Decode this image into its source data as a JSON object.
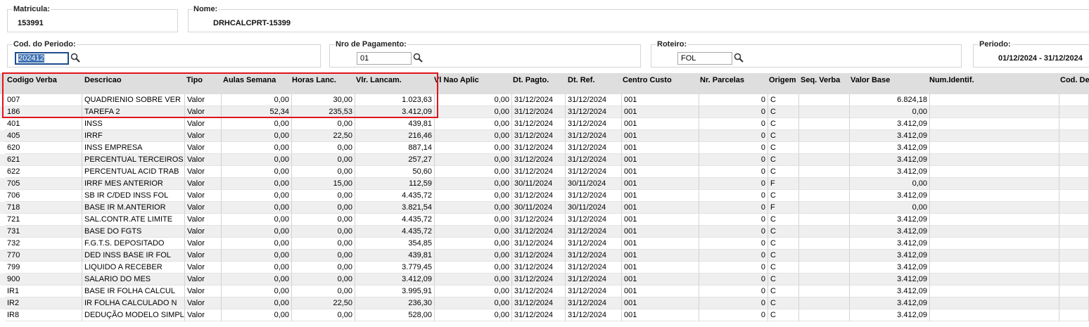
{
  "matricula": {
    "label": "Matricula:",
    "value": "153991"
  },
  "nome": {
    "label": "Nome:",
    "value": "DRHCALCPRT-15399"
  },
  "cod_periodo": {
    "label": "Cod. do Periodo:",
    "value": "202412"
  },
  "nro_pagamento": {
    "label": "Nro de Pagamento:",
    "value": "01"
  },
  "roteiro": {
    "label": "Roteiro:",
    "value": "FOL"
  },
  "periodo": {
    "label": "Periodo:",
    "value": "01/12/2024 - 31/12/2024"
  },
  "icons": {
    "search": "magnifier-icon"
  },
  "colors": {
    "highlight": "#e0141b",
    "header_bg": "#dedede",
    "row_alt": "#efefef"
  },
  "table": {
    "headers": [
      "Codigo Verba",
      "Descricao",
      "Tipo",
      "Aulas Semana",
      "Horas Lanc.",
      "Vlr. Lancam.",
      "Vl Nao Aplic",
      "Dt. Pagto.",
      "Dt. Ref.",
      "Centro Custo",
      "Nr. Parcelas",
      "Origem",
      "Seq. Verba",
      "Valor Base",
      "Num.Identif.",
      "Cod. De"
    ],
    "rows": [
      [
        "007",
        "QUADRIENIO SOBRE VER",
        "Valor",
        "0,00",
        "30,00",
        "1.023,63",
        "0,00",
        "31/12/2024",
        "31/12/2024",
        "001",
        "0",
        "C",
        "",
        "6.824,18",
        "",
        ""
      ],
      [
        "186",
        "TAREFA 2",
        "Valor",
        "52,34",
        "235,53",
        "3.412,09",
        "0,00",
        "31/12/2024",
        "31/12/2024",
        "001",
        "0",
        "C",
        "",
        "0,00",
        "",
        ""
      ],
      [
        "401",
        "INSS",
        "Valor",
        "0,00",
        "0,00",
        "439,81",
        "0,00",
        "31/12/2024",
        "31/12/2024",
        "001",
        "0",
        "C",
        "",
        "3.412,09",
        "",
        ""
      ],
      [
        "405",
        "IRRF",
        "Valor",
        "0,00",
        "22,50",
        "216,46",
        "0,00",
        "31/12/2024",
        "31/12/2024",
        "001",
        "0",
        "C",
        "",
        "3.412,09",
        "",
        ""
      ],
      [
        "620",
        "INSS EMPRESA",
        "Valor",
        "0,00",
        "0,00",
        "887,14",
        "0,00",
        "31/12/2024",
        "31/12/2024",
        "001",
        "0",
        "C",
        "",
        "3.412,09",
        "",
        ""
      ],
      [
        "621",
        "PERCENTUAL TERCEIROS",
        "Valor",
        "0,00",
        "0,00",
        "257,27",
        "0,00",
        "31/12/2024",
        "31/12/2024",
        "001",
        "0",
        "C",
        "",
        "3.412,09",
        "",
        ""
      ],
      [
        "622",
        "PERCENTUAL ACID TRAB",
        "Valor",
        "0,00",
        "0,00",
        "50,60",
        "0,00",
        "31/12/2024",
        "31/12/2024",
        "001",
        "0",
        "C",
        "",
        "3.412,09",
        "",
        ""
      ],
      [
        "705",
        "IRRF MES ANTERIOR",
        "Valor",
        "0,00",
        "15,00",
        "112,59",
        "0,00",
        "30/11/2024",
        "30/11/2024",
        "001",
        "0",
        "F",
        "",
        "0,00",
        "",
        ""
      ],
      [
        "706",
        "SB IR C/DED INSS FOL",
        "Valor",
        "0,00",
        "0,00",
        "4.435,72",
        "0,00",
        "31/12/2024",
        "31/12/2024",
        "001",
        "0",
        "C",
        "",
        "3.412,09",
        "",
        ""
      ],
      [
        "718",
        "BASE IR M.ANTERIOR",
        "Valor",
        "0,00",
        "0,00",
        "3.821,54",
        "0,00",
        "30/11/2024",
        "30/11/2024",
        "001",
        "0",
        "F",
        "",
        "0,00",
        "",
        ""
      ],
      [
        "721",
        "SAL.CONTR.ATE LIMITE",
        "Valor",
        "0,00",
        "0,00",
        "4.435,72",
        "0,00",
        "31/12/2024",
        "31/12/2024",
        "001",
        "0",
        "C",
        "",
        "3.412,09",
        "",
        ""
      ],
      [
        "731",
        "BASE DO FGTS",
        "Valor",
        "0,00",
        "0,00",
        "4.435,72",
        "0,00",
        "31/12/2024",
        "31/12/2024",
        "001",
        "0",
        "C",
        "",
        "3.412,09",
        "",
        ""
      ],
      [
        "732",
        "F.G.T.S.  DEPOSITADO",
        "Valor",
        "0,00",
        "0,00",
        "354,85",
        "0,00",
        "31/12/2024",
        "31/12/2024",
        "001",
        "0",
        "C",
        "",
        "3.412,09",
        "",
        ""
      ],
      [
        "770",
        "DED INSS BASE IR FOL",
        "Valor",
        "0,00",
        "0,00",
        "439,81",
        "0,00",
        "31/12/2024",
        "31/12/2024",
        "001",
        "0",
        "C",
        "",
        "3.412,09",
        "",
        ""
      ],
      [
        "799",
        "LIQUIDO A RECEBER",
        "Valor",
        "0,00",
        "0,00",
        "3.779,45",
        "0,00",
        "31/12/2024",
        "31/12/2024",
        "001",
        "0",
        "C",
        "",
        "3.412,09",
        "",
        ""
      ],
      [
        "900",
        "SALARIO DO MES",
        "Valor",
        "0,00",
        "0,00",
        "3.412,09",
        "0,00",
        "31/12/2024",
        "31/12/2024",
        "001",
        "0",
        "C",
        "",
        "3.412,09",
        "",
        ""
      ],
      [
        "IR1",
        "BASE IR FOLHA CALCUL",
        "Valor",
        "0,00",
        "0,00",
        "3.995,91",
        "0,00",
        "31/12/2024",
        "31/12/2024",
        "001",
        "0",
        "C",
        "",
        "3.412,09",
        "",
        ""
      ],
      [
        "IR2",
        "IR FOLHA CALCULADO N",
        "Valor",
        "0,00",
        "22,50",
        "236,30",
        "0,00",
        "31/12/2024",
        "31/12/2024",
        "001",
        "0",
        "C",
        "",
        "3.412,09",
        "",
        ""
      ],
      [
        "IR8",
        "DEDUÇÃO MODELO SIMPL",
        "Valor",
        "0,00",
        "0,00",
        "528,00",
        "0,00",
        "31/12/2024",
        "31/12/2024",
        "001",
        "0",
        "C",
        "",
        "3.412,09",
        "",
        ""
      ]
    ]
  }
}
